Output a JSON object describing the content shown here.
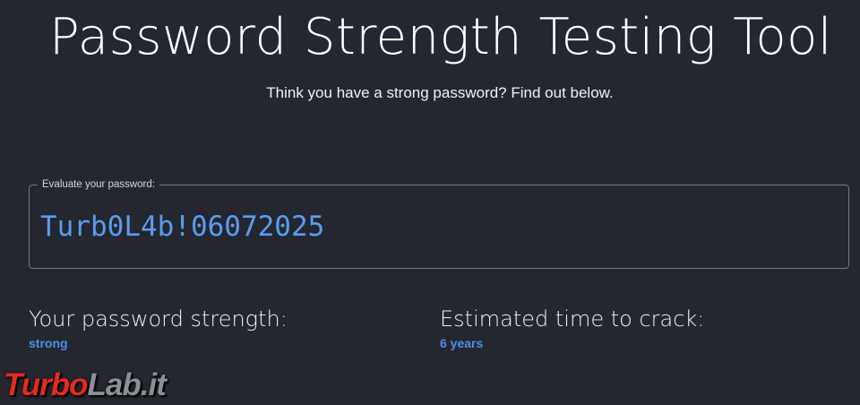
{
  "header": {
    "title": "Password Strength Testing Tool",
    "subtitle": "Think you have a strong password? Find out below."
  },
  "password_field": {
    "legend": "Evaluate your password:",
    "value": "Turb0L4b!06072025"
  },
  "results": {
    "strength_label": "Your password strength:",
    "strength_value": "strong",
    "crack_label": "Estimated time to crack:",
    "crack_value": "6 years"
  },
  "watermark": {
    "part1": "Turbo",
    "part2": "Lab.it"
  },
  "colors": {
    "background": "#24272f",
    "accent": "#4f8fe8",
    "watermark_red": "#e52b20"
  }
}
